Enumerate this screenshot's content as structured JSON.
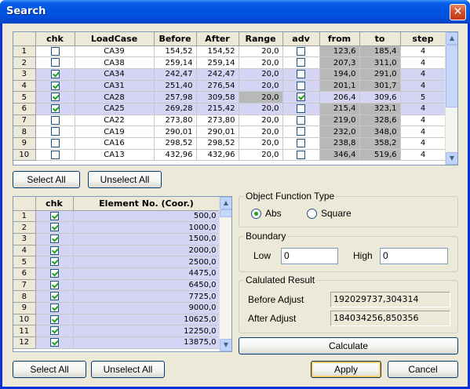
{
  "window": {
    "title": "Search",
    "close_glyph": "✕"
  },
  "top_grid": {
    "columns": [
      "",
      "chk",
      "LoadCase",
      "Before",
      "After",
      "Range",
      "adv",
      "from",
      "to",
      "step"
    ],
    "rows": [
      {
        "n": "1",
        "chk": false,
        "lc": "CA39",
        "before": "154,52",
        "after": "154,52",
        "range": "20,0",
        "adv": false,
        "from": "123,6",
        "to": "185,4",
        "step": "4",
        "sel": false
      },
      {
        "n": "2",
        "chk": false,
        "lc": "CA38",
        "before": "259,14",
        "after": "259,14",
        "range": "20,0",
        "adv": false,
        "from": "207,3",
        "to": "311,0",
        "step": "4",
        "sel": false
      },
      {
        "n": "3",
        "chk": true,
        "lc": "CA34",
        "before": "242,47",
        "after": "242,47",
        "range": "20,0",
        "adv": false,
        "from": "194,0",
        "to": "291,0",
        "step": "4",
        "sel": true
      },
      {
        "n": "4",
        "chk": true,
        "lc": "CA31",
        "before": "251,40",
        "after": "276,54",
        "range": "20,0",
        "adv": false,
        "from": "201,1",
        "to": "301,7",
        "step": "4",
        "sel": true
      },
      {
        "n": "5",
        "chk": true,
        "lc": "CA28",
        "before": "257,98",
        "after": "309,58",
        "range": "20,0",
        "adv": true,
        "from": "206,4",
        "to": "309,6",
        "step": "5",
        "sel": true
      },
      {
        "n": "6",
        "chk": true,
        "lc": "CA25",
        "before": "269,28",
        "after": "215,42",
        "range": "20,0",
        "adv": false,
        "from": "215,4",
        "to": "323,1",
        "step": "4",
        "sel": true
      },
      {
        "n": "7",
        "chk": false,
        "lc": "CA22",
        "before": "273,80",
        "after": "273,80",
        "range": "20,0",
        "adv": false,
        "from": "219,0",
        "to": "328,6",
        "step": "4",
        "sel": false
      },
      {
        "n": "8",
        "chk": false,
        "lc": "CA19",
        "before": "290,01",
        "after": "290,01",
        "range": "20,0",
        "adv": false,
        "from": "232,0",
        "to": "348,0",
        "step": "4",
        "sel": false
      },
      {
        "n": "9",
        "chk": false,
        "lc": "CA16",
        "before": "298,52",
        "after": "298,52",
        "range": "20,0",
        "adv": false,
        "from": "238,8",
        "to": "358,2",
        "step": "4",
        "sel": false
      },
      {
        "n": "10",
        "chk": false,
        "lc": "CA13",
        "before": "432,96",
        "after": "432,96",
        "range": "20,0",
        "adv": false,
        "from": "346,4",
        "to": "519,6",
        "step": "4",
        "sel": false
      }
    ]
  },
  "top_buttons": {
    "select_all": "Select All",
    "unselect_all": "Unselect All"
  },
  "element_grid": {
    "columns": [
      "",
      "chk",
      "Element No. (Coor.)"
    ],
    "rows": [
      {
        "n": "1",
        "chk": true,
        "value": "500,0"
      },
      {
        "n": "2",
        "chk": true,
        "value": "1000,0"
      },
      {
        "n": "3",
        "chk": true,
        "value": "1500,0"
      },
      {
        "n": "4",
        "chk": true,
        "value": "2000,0"
      },
      {
        "n": "5",
        "chk": true,
        "value": "2500,0"
      },
      {
        "n": "6",
        "chk": true,
        "value": "4475,0"
      },
      {
        "n": "7",
        "chk": true,
        "value": "6450,0"
      },
      {
        "n": "8",
        "chk": true,
        "value": "7725,0"
      },
      {
        "n": "9",
        "chk": true,
        "value": "9000,0"
      },
      {
        "n": "10",
        "chk": true,
        "value": "10625,0"
      },
      {
        "n": "11",
        "chk": true,
        "value": "12250,0"
      },
      {
        "n": "12",
        "chk": true,
        "value": "13875,0"
      }
    ]
  },
  "object_function": {
    "legend": "Object Function Type",
    "abs_label": "Abs",
    "square_label": "Square",
    "selected": "Abs"
  },
  "boundary": {
    "legend": "Boundary",
    "low_label": "Low",
    "low_value": "0",
    "high_label": "High",
    "high_value": "0"
  },
  "result": {
    "legend": "Calulated Result",
    "before_label": "Before Adjust",
    "before_value": "192029737,304314",
    "after_label": "After Adjust",
    "after_value": "184034256,850356"
  },
  "buttons": {
    "calculate": "Calculate",
    "select_all": "Select All",
    "unselect_all": "Unselect All",
    "apply": "Apply",
    "cancel": "Cancel"
  }
}
